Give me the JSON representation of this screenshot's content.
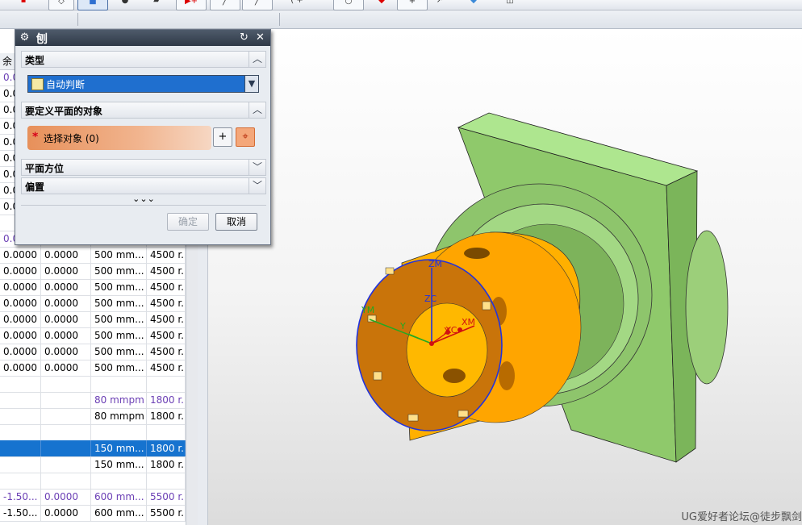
{
  "colors": {
    "selection": "#1673cf",
    "purple_text": "#6b3fb5",
    "part_orange": "#ffb000",
    "part_green": "#9fd27a",
    "dialog_title": "#2f3947"
  },
  "toolbar": {
    "icons": [
      "dotted-line-icon",
      "view-orientation-icon",
      "shaded-cube-icon",
      "cylinder-icon",
      "surface-icon",
      "snap-point-icon",
      "line-icon",
      "arc-icon",
      "circle-icon",
      "point-icon",
      "move-icon",
      "cube-icon",
      "wireframe-icon"
    ]
  },
  "left_table": {
    "header_fragment": "余",
    "rows": [
      {
        "c1": "0.0",
        "c2": "",
        "c3": "",
        "c4": "",
        "style": "purple"
      },
      {
        "c1": "0.0",
        "c2": "",
        "c3": "",
        "c4": ""
      },
      {
        "c1": "0.0",
        "c2": "",
        "c3": "",
        "c4": ""
      },
      {
        "c1": "0.0",
        "c2": "",
        "c3": "",
        "c4": ""
      },
      {
        "c1": "0.0",
        "c2": "",
        "c3": "",
        "c4": ""
      },
      {
        "c1": "0.0",
        "c2": "",
        "c3": "",
        "c4": ""
      },
      {
        "c1": "0.0",
        "c2": "",
        "c3": "",
        "c4": ""
      },
      {
        "c1": "0.0",
        "c2": "",
        "c3": "",
        "c4": ""
      },
      {
        "c1": "0.0",
        "c2": "",
        "c3": "",
        "c4": ""
      },
      {
        "c1": "",
        "c2": "",
        "c3": "",
        "c4": ""
      },
      {
        "c1": "0.0",
        "c2": "",
        "c3": "",
        "c4": "",
        "style": "purple"
      },
      {
        "c1": "0.0000",
        "c2": "0.0000",
        "c3": "500 mm...",
        "c4": "4500 r..."
      },
      {
        "c1": "0.0000",
        "c2": "0.0000",
        "c3": "500 mm...",
        "c4": "4500 r..."
      },
      {
        "c1": "0.0000",
        "c2": "0.0000",
        "c3": "500 mm...",
        "c4": "4500 r..."
      },
      {
        "c1": "0.0000",
        "c2": "0.0000",
        "c3": "500 mm...",
        "c4": "4500 r..."
      },
      {
        "c1": "0.0000",
        "c2": "0.0000",
        "c3": "500 mm...",
        "c4": "4500 r..."
      },
      {
        "c1": "0.0000",
        "c2": "0.0000",
        "c3": "500 mm...",
        "c4": "4500 r..."
      },
      {
        "c1": "0.0000",
        "c2": "0.0000",
        "c3": "500 mm...",
        "c4": "4500 r..."
      },
      {
        "c1": "0.0000",
        "c2": "0.0000",
        "c3": "500 mm...",
        "c4": "4500 r..."
      },
      {
        "c1": "",
        "c2": "",
        "c3": "",
        "c4": ""
      },
      {
        "c1": "",
        "c2": "",
        "c3": "80 mmpm",
        "c4": "1800 r...",
        "style": "purple"
      },
      {
        "c1": "",
        "c2": "",
        "c3": "80 mmpm",
        "c4": "1800 r..."
      },
      {
        "c1": "",
        "c2": "",
        "c3": "",
        "c4": ""
      },
      {
        "c1": "",
        "c2": "",
        "c3": "150 mm...",
        "c4": "1800 r...",
        "style": "selected"
      },
      {
        "c1": "",
        "c2": "",
        "c3": "150 mm...",
        "c4": "1800 r..."
      },
      {
        "c1": "",
        "c2": "",
        "c3": "",
        "c4": ""
      },
      {
        "c1": "-1.50...",
        "c2": "0.0000",
        "c3": "600 mm...",
        "c4": "5500 r...",
        "style": "purple"
      },
      {
        "c1": "-1.50...",
        "c2": "0.0000",
        "c3": "600 mm...",
        "c4": "5500 r..."
      }
    ]
  },
  "dialog": {
    "title": "刨",
    "sections": {
      "type": "类型",
      "objects": "要定义平面的对象",
      "orientation": "平面方位",
      "offset": "偏置"
    },
    "type_value": "自动判断",
    "select_object": "选择对象 (0)",
    "ok": "确定",
    "cancel": "取消",
    "more_icon": "⌄⌄⌄"
  },
  "viewport": {
    "axis_labels": [
      "ZM",
      "ZC",
      "YM",
      "Y",
      "X",
      "XC",
      "XM"
    ],
    "watermark": "UG爱好者论坛@徒步飘剑"
  }
}
